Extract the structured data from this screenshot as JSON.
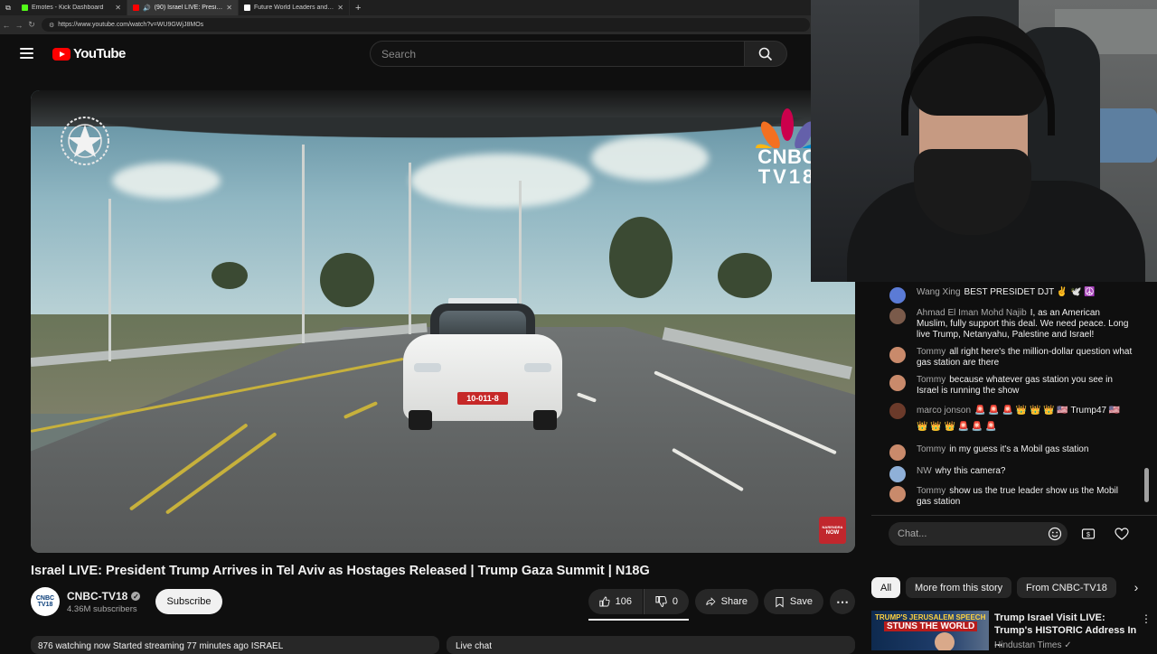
{
  "browser": {
    "tabs": [
      {
        "title": "Emotes - Kick Dashboard",
        "color": "#53fc18",
        "active": false
      },
      {
        "title": "(90) Israel LIVE: President Tru",
        "color": "#ff0000",
        "active": true
      },
      {
        "title": "Future World Leaders and Their F",
        "color": "#ffffff",
        "active": false
      }
    ],
    "new_tab": "+",
    "url": "https://www.youtube.com/watch?v=WU9GWjJ8MOs"
  },
  "masthead": {
    "logo_text": "YouTube",
    "search_placeholder": "Search"
  },
  "video": {
    "overlay_brand_line1": "CNBC",
    "overlay_brand_line2": "TV18",
    "plate": "10-011-8",
    "badge_line1": "NARENDRA",
    "badge_line2": "NOW",
    "title": "Israel LIVE: President Trump Arrives in Tel Aviv as Hostages Released | Trump Gaza Summit | N18G"
  },
  "channel": {
    "name": "CNBC-TV18",
    "avatar_line1": "CNBC",
    "avatar_line2": "TV18",
    "subscribers": "4.36M subscribers",
    "subscribe_label": "Subscribe"
  },
  "actions": {
    "likes": "106",
    "dislikes": "0",
    "share": "Share",
    "save": "Save"
  },
  "description_preview": "876 watching now  Started streaming 77 minutes ago  ISRAEL",
  "live_chat_header": "Live chat",
  "chat": {
    "messages": [
      {
        "author": "Wang Xing",
        "text": "BEST PRESIDET DJT ✌️ 🕊️ ☮️",
        "avatar_color": "#5b7bd6"
      },
      {
        "author": "Ahmad El Iman Mohd Najib",
        "text": "I, as an American Muslim, fully support this deal. We need peace. Long live Trump, Netanyahu, Palestine and Israel!",
        "avatar_color": "#7a5a4a"
      },
      {
        "author": "Tommy",
        "text": "all right here's the million-dollar question what gas station are there",
        "avatar_color": "#c98a6b"
      },
      {
        "author": "Tommy",
        "text": "because whatever gas station you see in Israel is running the show",
        "avatar_color": "#c98a6b"
      },
      {
        "author": "marco jonson",
        "text": "🚨 🚨 🚨 👑 👑 👑 🇺🇸 Trump47 🇺🇸 👑 👑 👑 🚨 🚨 🚨",
        "avatar_color": "#6b3a2a"
      },
      {
        "author": "Tommy",
        "text": "in my guess it's a Mobil gas station",
        "avatar_color": "#c98a6b"
      },
      {
        "author": "NW",
        "text": "why this camera?",
        "avatar_color": "#8fb0d8"
      },
      {
        "author": "Tommy",
        "text": "show us the true leader show us the Mobil gas station",
        "avatar_color": "#c98a6b"
      }
    ],
    "input_placeholder": "Chat..."
  },
  "chips": [
    "All",
    "More from this story",
    "From CNBC-TV18"
  ],
  "recommended": {
    "thumb_line1": "TRUMP'S JERUSALEM SPEECH",
    "thumb_line2": "STUNS THE WORLD",
    "title": "Trump Israel Visit LIVE: Trump's HISTORIC Address In ...",
    "channel": "Hindustan Times"
  }
}
